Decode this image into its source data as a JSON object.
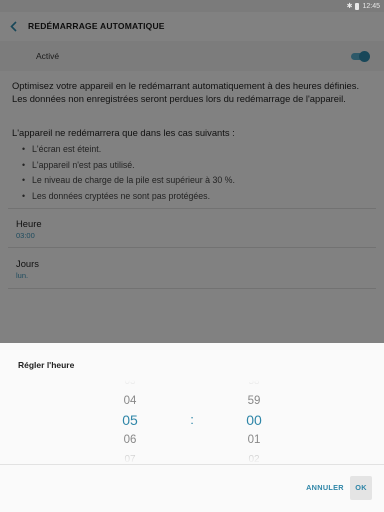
{
  "status_bar": {
    "time": "12:45",
    "icons": [
      "bluetooth-icon",
      "battery-icon"
    ]
  },
  "app_bar": {
    "title": "REDÉMARRAGE AUTOMATIQUE"
  },
  "master_switch": {
    "label": "Activé",
    "on": true
  },
  "description": "Optimisez votre appareil en le redémarrant automatiquement à des heures définies. Les données non enregistrées seront perdues lors du redémarrage de l'appareil.",
  "cases": {
    "title": "L'appareil ne redémarrera que dans les cas suivants :",
    "items": [
      "L'écran est éteint.",
      "L'appareil n'est pas utilisé.",
      "Le niveau de charge de la pile est supérieur à 30 %.",
      "Les données cryptées ne sont pas protégées."
    ]
  },
  "settings": {
    "hour": {
      "title": "Heure",
      "value": "03:00"
    },
    "days": {
      "title": "Jours",
      "value": "lun."
    }
  },
  "time_dialog": {
    "title": "Régler l'heure",
    "hours": [
      "03",
      "04",
      "05",
      "06",
      "07"
    ],
    "minutes": [
      "58",
      "59",
      "00",
      "01",
      "02"
    ],
    "separator": ":",
    "selected_hour": "05",
    "selected_minute": "00",
    "cancel_label": "ANNULER",
    "ok_label": "OK"
  },
  "colors": {
    "accent": "#2f86a8",
    "dim": "#7a7a7a"
  }
}
